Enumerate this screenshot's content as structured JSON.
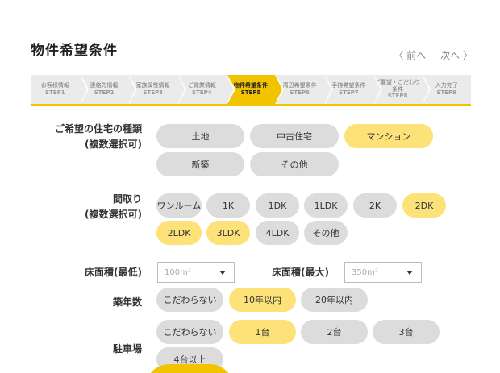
{
  "title": "物件希望条件",
  "pager": {
    "prev": "〈 前へ",
    "next": "次へ 〉"
  },
  "steps": [
    {
      "label": "お客様情報",
      "num": "STEP1"
    },
    {
      "label": "連絡先情報",
      "num": "STEP2"
    },
    {
      "label": "家族属性情報",
      "num": "STEP3"
    },
    {
      "label": "ご職業情報",
      "num": "STEP4"
    },
    {
      "label": "物件希望条件",
      "num": "STEP5"
    },
    {
      "label": "周辺希望条件",
      "num": "STEP6"
    },
    {
      "label": "手持希望条件",
      "num": "STEP7"
    },
    {
      "label": "ご要望・こだわり条件",
      "num": "STEP8"
    },
    {
      "label": "入力完了",
      "num": "STEP9"
    }
  ],
  "housing_type": {
    "label_line1": "ご希望の住宅の種類",
    "label_line2": "(複数選択可)",
    "options": [
      "土地",
      "中古住宅",
      "マンション",
      "新築",
      "その他"
    ]
  },
  "layout": {
    "label_line1": "間取り",
    "label_line2": "(複数選択可)",
    "options": [
      "ワンルーム",
      "1K",
      "1DK",
      "1LDK",
      "2K",
      "2DK",
      "2LDK",
      "3LDK",
      "4LDK",
      "その他"
    ]
  },
  "floor_area": {
    "min_label": "床面積(最低)",
    "min_value": "100m²",
    "max_label": "床面積(最大)",
    "max_value": "350m²"
  },
  "age": {
    "label": "築年数",
    "options": [
      "こだわらない",
      "10年以内",
      "20年以内"
    ]
  },
  "parking": {
    "label": "駐車場",
    "options": [
      "こだわらない",
      "1台",
      "2台",
      "3台",
      "4台以上"
    ]
  }
}
